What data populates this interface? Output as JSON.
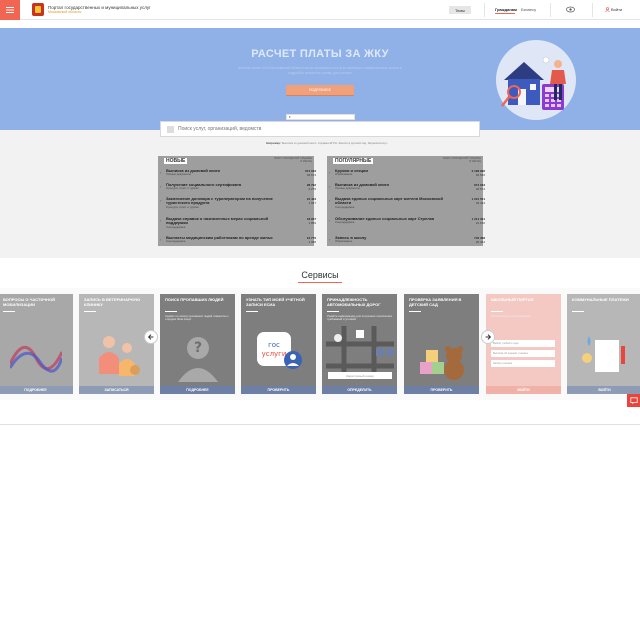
{
  "header": {
    "site_title": "Портал государственных и муниципальных услуг",
    "site_subtitle": "Московской области",
    "themes_label": "Темы",
    "citizens_label": "Гражданам",
    "business_label": "Бизнесу",
    "login_label": "Войти"
  },
  "banner": {
    "title": "РАСЧЕТ ПЛАТЫ ЗА ЖКУ",
    "text": "Жители более 40% Московской области могут проверить плату за жилищно-коммунальные услуги и подробно посчитать сумму для оплаты",
    "button": "ПОДРОБНЕЕ"
  },
  "search": {
    "region": "",
    "placeholder": "Поиск услуг, организаций, ведомств",
    "popular_label": "Например:",
    "popular_items": "Выписка из домовой книги, Справка ЕГРН, Записи в детский сад, Загранпаспорт..."
  },
  "lists": {
    "new": {
      "title": "НОВЫЕ",
      "stat_label": "ВСЕГО ОБРАЩЕНИЙ СРЕДНЕЕ В МЕСЯЦ",
      "items": [
        {
          "title": "Выписка из домовой книги",
          "cat": "Личные документы",
          "n1": "674 033",
          "n2": "34 674"
        },
        {
          "title": "Получение социального сертификата",
          "cat": "Культура, спорт и туризм",
          "n1": "28 792",
          "n2": "2 276"
        },
        {
          "title": "Заключение договора с туроператором на получение туристского продукта",
          "cat": "Культура, спорт и туризм",
          "n1": "24 423",
          "n2": "1 947"
        },
        {
          "title": "Выдача справок о назначенных мерах социальной поддержки",
          "cat": "Соцподдержка",
          "n1": "18 937",
          "n2": "1 859"
        },
        {
          "title": "Выплаты медицинским работникам по аренде жилья",
          "cat": "Соцподдержка",
          "n1": "16 776",
          "n2": "1 398"
        }
      ]
    },
    "popular": {
      "title": "ПОПУЛЯРНЫЕ",
      "stat_label": "ВСЕГО ОБРАЩЕНИЙ СРЕДНЕЕ В МЕСЯЦ",
      "items": [
        {
          "title": "Кружки и секции",
          "cat": "Образование",
          "n1": "2 198 996",
          "n2": "64 526"
        },
        {
          "title": "Выписка из домовой книги",
          "cat": "Личные документы",
          "n1": "674 033",
          "n2": "34 674"
        },
        {
          "title": "Выдача единых социальных карт жителя Московской области",
          "cat": "Соцподдержка",
          "n1": "1 201 501",
          "n2": "34 434"
        },
        {
          "title": "Обслуживание единых социальных карт Стрелка",
          "cat": "Соцподдержка",
          "n1": "1 214 391",
          "n2": "21 150"
        },
        {
          "title": "Запись в школу",
          "cat": "Образование",
          "n1": "746 368",
          "n2": "20 464"
        }
      ]
    }
  },
  "services": {
    "title": "Сервисы",
    "cards": [
      {
        "title": "Вопросы о частичной мобилизации",
        "desc": "",
        "button": "ПОДРОБНЕЕ"
      },
      {
        "title": "Запись в ветеринарную клинику",
        "desc": "",
        "button": "ЗАПИСАТЬСЯ"
      },
      {
        "title": "Поиск пропавших людей",
        "desc": "Сервис по поиску пропавших людей совместно с отрядом Лиза Алерт",
        "button": "ПОДРОБНЕЕ"
      },
      {
        "title": "Узнать тип моей учетной записи ЕСИА",
        "desc": "",
        "button": "ПРОВЕРИТЬ"
      },
      {
        "title": "Принадлежность автомобильных дорог",
        "desc": "Узнайте информацию для получения технических требований и условий",
        "button": "ОПРЕДЕЛИТЬ",
        "input_placeholder": "Кадастровый номер"
      },
      {
        "title": "Проверка заявления в детский сад",
        "desc": "",
        "button": "ПРОВЕРИТЬ"
      },
      {
        "title": "Школьный портал",
        "desc": "Регистрация и поиск дневника",
        "button": "ВОЙТИ",
        "fields": [
          "Выбор учебного года",
          "Выписка об оценках ученика",
          "Записи ученика"
        ]
      },
      {
        "title": "Коммунальные платежи",
        "desc": "",
        "button": "ВОЙТИ"
      }
    ]
  },
  "colors": {
    "accent": "#f26552",
    "banner": "#8fb1e8",
    "button_blue": "#6d7fa5"
  }
}
